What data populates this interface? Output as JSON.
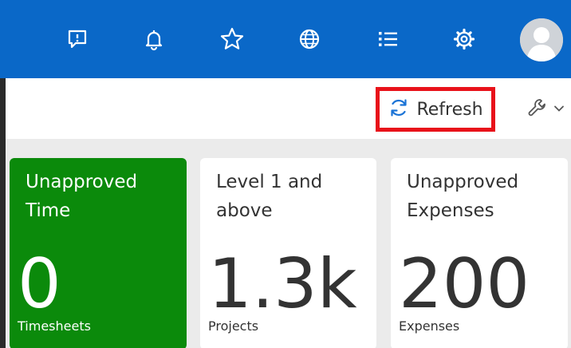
{
  "colors": {
    "header_bg": "#0a68c8",
    "highlight_border": "#e8121a",
    "tile_green": "#0b8a0b",
    "content_bg": "#ebebeb"
  },
  "header": {
    "icons": [
      "feedback-icon",
      "bell-icon",
      "star-icon",
      "globe-icon",
      "list-icon",
      "gear-icon"
    ],
    "avatar": "user-avatar-icon"
  },
  "toolbar": {
    "refresh_label": "Refresh",
    "tools_icon": "wrench-icon",
    "tools_dropdown_icon": "chevron-down-icon"
  },
  "tiles": [
    {
      "title": "Unapproved Time",
      "value": "0",
      "caption": "Timesheets",
      "color": "green"
    },
    {
      "title": "Level 1 and above",
      "value": "1.3k",
      "caption": "Projects",
      "color": "white"
    },
    {
      "title": "Unapproved Expenses",
      "value": "200",
      "caption": "Expenses",
      "color": "white"
    }
  ]
}
